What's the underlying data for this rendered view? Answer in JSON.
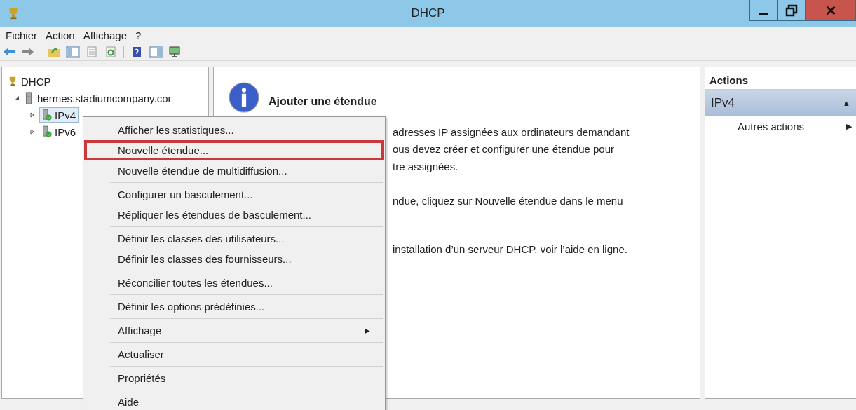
{
  "window": {
    "title": "DHCP"
  },
  "menu_bar": [
    "Fichier",
    "Action",
    "Affichage",
    "?"
  ],
  "tree": {
    "label": "DHCP",
    "children": [
      {
        "label": "hermes.stadiumcompany.cor",
        "expanded": true,
        "children": [
          {
            "label": "IPv4",
            "selected": true,
            "expanded": false
          },
          {
            "label": "IPv6",
            "selected": false,
            "expanded": false
          }
        ]
      }
    ]
  },
  "content": {
    "title": "Ajouter une étendue",
    "paragraphs": [
      [
        "adresses IP assignées aux ordinateurs demandant",
        "ous devez créer et configurer une étendue pour",
        "tre assignées."
      ],
      [
        "ndue, cliquez sur Nouvelle étendue dans le menu"
      ],
      [
        "installation d’un serveur DHCP, voir l’aide en ligne."
      ]
    ]
  },
  "actions_pane": {
    "title": "Actions",
    "section": {
      "label": "IPv4",
      "collapse_glyph": "▲",
      "items": [
        {
          "label": "Autres actions",
          "arrow": "▶"
        }
      ]
    }
  },
  "context_menu": {
    "groups": [
      [
        {
          "label": "Afficher les statistiques...",
          "highlighted": false
        },
        {
          "label": "Nouvelle étendue...",
          "highlighted": true
        },
        {
          "label": "Nouvelle étendue de multidiffusion...",
          "highlighted": false
        }
      ],
      [
        {
          "label": "Configurer un basculement...",
          "highlighted": false
        },
        {
          "label": "Répliquer les étendues de basculement...",
          "highlighted": false
        }
      ],
      [
        {
          "label": "Définir les classes des utilisateurs...",
          "highlighted": false
        },
        {
          "label": "Définir les classes des fournisseurs...",
          "highlighted": false
        }
      ],
      [
        {
          "label": "Réconcilier toutes les étendues...",
          "highlighted": false
        }
      ],
      [
        {
          "label": "Définir les options prédéfinies...",
          "highlighted": false
        }
      ],
      [
        {
          "label": "Affichage",
          "highlighted": false,
          "arrow": "▶"
        }
      ],
      [
        {
          "label": "Actualiser",
          "highlighted": false
        }
      ],
      [
        {
          "label": "Propriétés",
          "highlighted": false
        }
      ],
      [
        {
          "label": "Aide",
          "highlighted": false
        }
      ]
    ]
  }
}
